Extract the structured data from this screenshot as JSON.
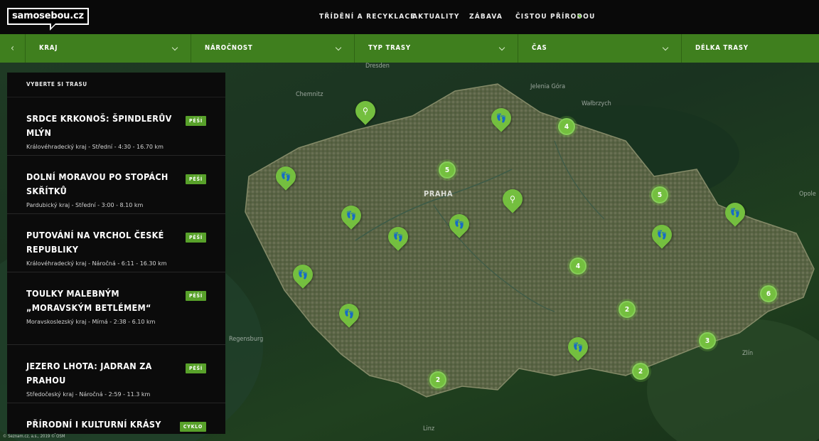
{
  "header": {
    "logo": "samosebou.cz",
    "nav": [
      "TŘÍDĚNÍ A RECYKLACE",
      "AKTUALITY",
      "ZÁBAVA",
      "ČISTOU PŘÍRODOU"
    ]
  },
  "filters": {
    "back_icon": "‹",
    "items": [
      "KRAJ",
      "NÁROČNOST",
      "TYP TRASY",
      "ČAS",
      "DÉLKA TRASY"
    ]
  },
  "panel": {
    "heading": "VYBERTE SI TRASU",
    "routes": [
      {
        "title": "SRDCE KRKONOŠ: ŠPINDLERŮV MLÝN",
        "meta": "Královéhradecký kraj - Střední - 4:30 - 16.70 km",
        "type": "PĚŠÍ"
      },
      {
        "title": "DOLNÍ MORAVOU PO STOPÁCH SKŘÍTKŮ",
        "meta": "Pardubický kraj - Střední - 3:00 - 8.10 km",
        "type": "PĚŠÍ"
      },
      {
        "title": "PUTOVÁNÍ NA VRCHOL ČESKÉ REPUBLIKY",
        "meta": "Královéhradecký kraj - Náročná - 6:11 - 16.30 km",
        "type": "PĚŠÍ"
      },
      {
        "title": "TOULKY MALEBNÝM „MORAVSKÝM BETLÉMEM“",
        "meta": "Moravskoslezský kraj - Mírná - 2:38 - 6.10 km",
        "type": "PĚŠÍ"
      },
      {
        "title": "JEZERO LHOTA: JADRAN ZA PRAHOU",
        "meta": "Středočeský kraj - Náročná - 2:59 - 11.3 km",
        "type": "PĚŠÍ"
      },
      {
        "title": "PŘÍRODNÍ I KULTURNÍ KRÁSY KUTNÉ",
        "meta": "",
        "type": "CYKLO"
      }
    ]
  },
  "map": {
    "capital": "PRAHA",
    "places": [
      "Dresden",
      "Jelenia Góra",
      "Wałbrzych",
      "Opole",
      "Chemnitz",
      "Regensburg",
      "Linz",
      "Zlín"
    ],
    "copyright": "© Seznam.cz, a.s., 2019 © OSM",
    "markers": [
      {
        "kind": "pin",
        "icon": "bike-icon",
        "glyph": "⚲"
      },
      {
        "kind": "pin",
        "icon": "footprints-icon",
        "glyph": "👣"
      },
      {
        "kind": "cluster",
        "count": "4"
      },
      {
        "kind": "pin",
        "icon": "footprints-icon",
        "glyph": "👣"
      },
      {
        "kind": "cluster",
        "count": "5"
      },
      {
        "kind": "pin",
        "icon": "bike-icon",
        "glyph": "⚲"
      },
      {
        "kind": "cluster",
        "count": "5"
      },
      {
        "kind": "pin",
        "icon": "footprints-icon",
        "glyph": "👣"
      },
      {
        "kind": "pin",
        "icon": "footprints-icon",
        "glyph": "👣"
      },
      {
        "kind": "pin",
        "icon": "footprints-icon",
        "glyph": "👣"
      },
      {
        "kind": "pin",
        "icon": "footprints-icon",
        "glyph": "👣"
      },
      {
        "kind": "pin",
        "icon": "footprints-icon",
        "glyph": "👣"
      },
      {
        "kind": "cluster",
        "count": "4"
      },
      {
        "kind": "pin",
        "icon": "footprints-icon",
        "glyph": "👣"
      },
      {
        "kind": "cluster",
        "count": "6"
      },
      {
        "kind": "pin",
        "icon": "footprints-icon",
        "glyph": "👣"
      },
      {
        "kind": "cluster",
        "count": "2"
      },
      {
        "kind": "cluster",
        "count": "3"
      },
      {
        "kind": "pin",
        "icon": "footprints-icon",
        "glyph": "👣"
      },
      {
        "kind": "cluster",
        "count": "2"
      },
      {
        "kind": "cluster",
        "count": "2"
      }
    ]
  },
  "colors": {
    "accent": "#3f7f1e",
    "marker": "#74bf3f",
    "badge": "#58a12a"
  }
}
